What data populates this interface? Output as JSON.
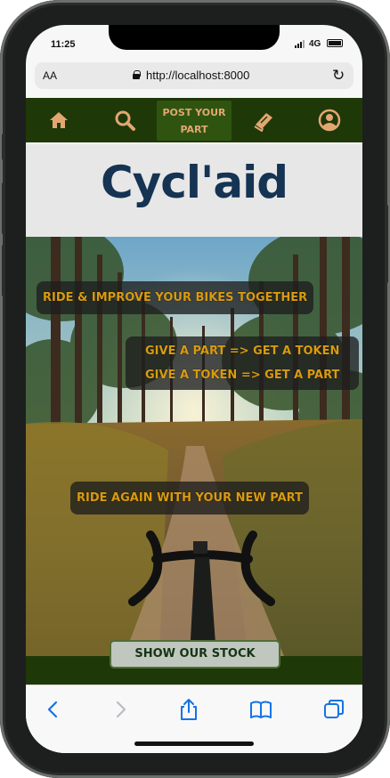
{
  "status": {
    "time": "11:25",
    "network": "4G"
  },
  "browser": {
    "text_size_label": "AA",
    "url": "http://localhost:8000"
  },
  "nav": {
    "icons": [
      "home-icon",
      "search-icon",
      "book-icon",
      "user-icon"
    ],
    "post_label": "POST YOUR PART",
    "post_line1": "POST YOUR",
    "post_line2": "PART"
  },
  "brand": {
    "title": "Cycl'aid"
  },
  "hero": {
    "caption_top": "RIDE & IMPROVE YOUR BIKES TOGETHER",
    "caption_mid_1": "GIVE A PART => GET A TOKEN",
    "caption_mid_2": "GIVE A TOKEN => GET A PART",
    "caption_bottom": "RIDE AGAIN WITH YOUR NEW PART"
  },
  "cta": {
    "label": "SHOW OUR STOCK"
  },
  "toolbar": {
    "icons": [
      "back-icon",
      "forward-icon",
      "share-icon",
      "bookmarks-icon",
      "tabs-icon"
    ]
  },
  "colors": {
    "nav_bg": "#1f3808",
    "accent": "#e2a771",
    "title": "#153352",
    "caption_text": "#d99b10"
  }
}
